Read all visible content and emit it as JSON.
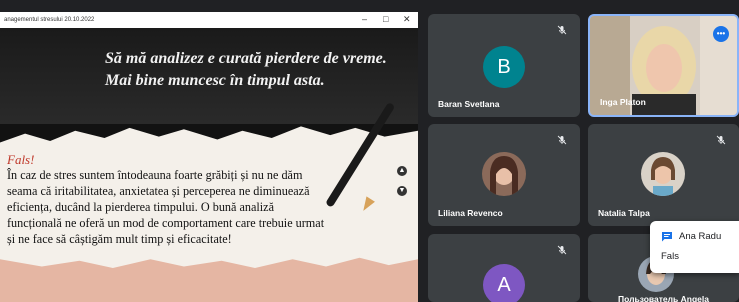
{
  "shared_screen": {
    "window_title": "anagementul stresului 20.10.2022",
    "window_controls": {
      "minimize": "–",
      "maximize": "□",
      "close": "✕"
    },
    "quote_line1": "Să mă analizez e curată pierdere de vreme.",
    "quote_line2": "Mai bine muncesc în timpul asta.",
    "fals_title": "Fals!",
    "body_lines": [
      "În caz de stres suntem întodeauna foarte grăbiți și nu ne dăm",
      "seama că iritabilitatea, anxietatea și perceperea ne diminuează",
      "eficiența, ducând la pierderea timpului. O bună analiză",
      "funcțională ne oferă un mod de comportament care trebuie urmat",
      "și ne face să câștigăm mult timp și eficacitate!"
    ],
    "nav_up": "▲",
    "nav_down": "▼"
  },
  "participants": [
    {
      "name": "Baran Svetlana",
      "initial": "B",
      "avatar_color": "#00838f",
      "muted": true
    },
    {
      "name": "Inga Platon",
      "speaking": true,
      "speaking_icon": "•••"
    },
    {
      "name": "Liliana Revenco",
      "muted": true
    },
    {
      "name": "Natalia Talpa",
      "muted": true
    },
    {
      "name": "",
      "initial": "A",
      "avatar_color": "#7e57c2",
      "muted": true
    },
    {
      "name": "Пользователь Angela"
    }
  ],
  "chat_notification": {
    "sender": "Ana Radu",
    "message": "Fals"
  },
  "colors": {
    "background": "#202124",
    "tile": "#3c4043",
    "accent": "#1a73e8"
  }
}
